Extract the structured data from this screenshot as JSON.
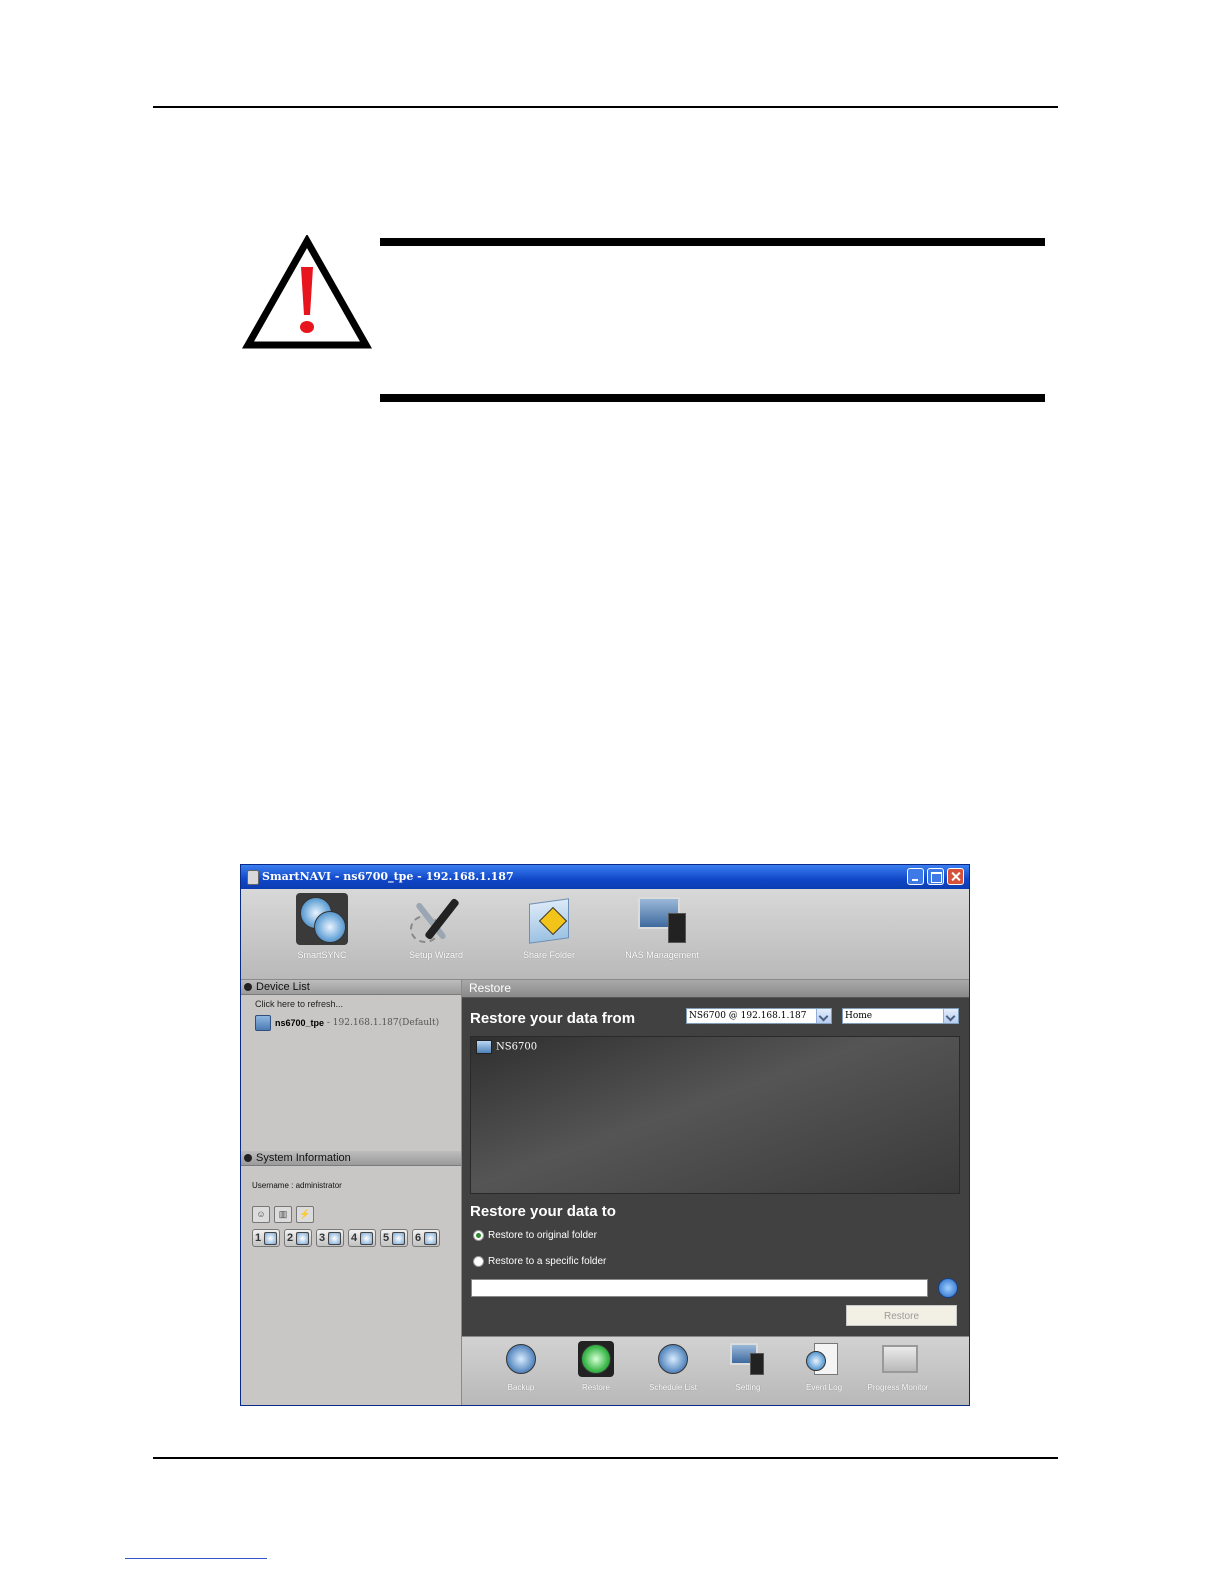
{
  "window": {
    "title": "SmartNAVI - ns6700_tpe - 192.168.1.187"
  },
  "toolbar": {
    "items": [
      {
        "label": "SmartSYNC",
        "icon": "sync-disk-icon"
      },
      {
        "label": "Setup Wizard",
        "icon": "wizard-tools-icon"
      },
      {
        "label": "Share Folder",
        "icon": "share-folder-icon"
      },
      {
        "label": "NAS Management",
        "icon": "nas-monitor-icon"
      }
    ]
  },
  "device_list": {
    "header": "Device List",
    "refresh": "Click here to refresh...",
    "device_name": "ns6700_tpe",
    "device_addr": " - 192.168.1.187(Default)"
  },
  "system_info": {
    "header": "System Information",
    "username": "Username : administrator",
    "disks": [
      "1",
      "2",
      "3",
      "4",
      "5",
      "6"
    ]
  },
  "restore": {
    "header": "Restore",
    "from_title": "Restore your data from",
    "device_select": "NS6700 @ 192.168.1.187",
    "share_select": "Home",
    "tree_root": "NS6700",
    "to_title": "Restore your data to",
    "option_original": "Restore to original folder",
    "option_specific": "Restore to a specific folder",
    "folder_value": "",
    "button": "Restore"
  },
  "bottom_toolbar": {
    "items": [
      {
        "label": "Backup"
      },
      {
        "label": "Restore"
      },
      {
        "label": "Schedule List"
      },
      {
        "label": "Setting"
      },
      {
        "label": "Event Log"
      },
      {
        "label": "Progress Monitor"
      }
    ]
  },
  "colors": {
    "titlebar": "#1047c8",
    "warning_red": "#e8141e",
    "panel_dark": "#414141"
  }
}
